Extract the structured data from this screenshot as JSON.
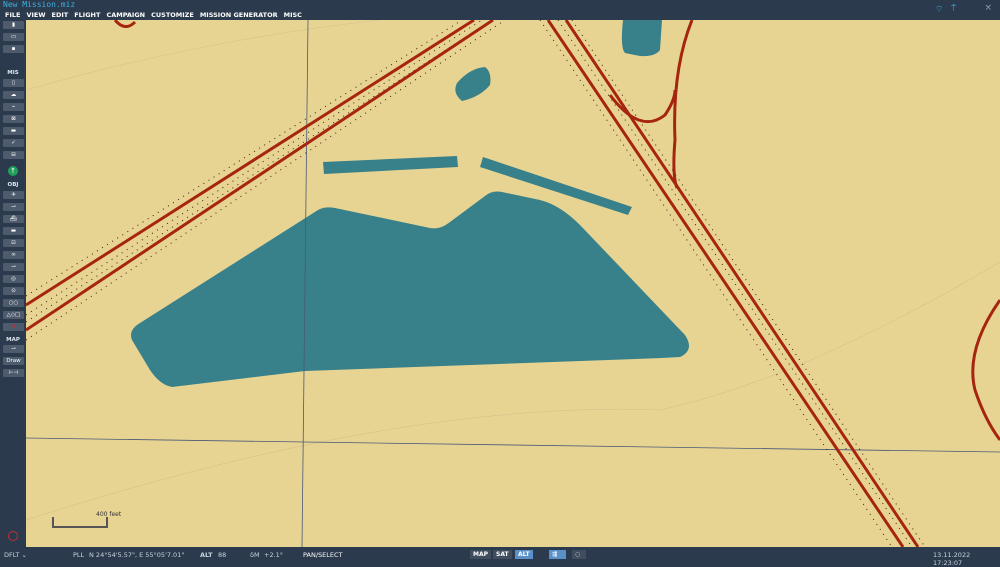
{
  "window": {
    "title": "New Mission.miz",
    "close": "×"
  },
  "menu": [
    "FILE",
    "VIEW",
    "EDIT",
    "FLIGHT",
    "CAMPAIGN",
    "CUSTOMIZE",
    "MISSION GENERATOR",
    "MISC"
  ],
  "sidebar": {
    "file_buttons": [
      "new-file",
      "open-file",
      "save-file"
    ],
    "mis_label": "MIS",
    "mis_buttons": [
      "briefing",
      "weather",
      "triggers",
      "goals",
      "failures",
      "check",
      "resources"
    ],
    "obj_label": "OBJ",
    "obj_buttons": [
      "airplane",
      "helicopter",
      "ship",
      "ground-vehicle",
      "static",
      "templates",
      "initial-point",
      "zone",
      "nav-target",
      "tacan",
      "shapes",
      "delete"
    ],
    "map_label": "MAP",
    "map_buttons": [
      "key",
      "Draw",
      "ruler"
    ]
  },
  "map": {
    "scale_label": "400 feet"
  },
  "status": {
    "profile": "DFLT ⌄",
    "coord_label": "PLL",
    "coords": "N 24°54'5.57\", E 55°05'7.01\"",
    "alt_label": "ALT",
    "alt": "88",
    "mag_label": "δM",
    "mag": "+2.1°",
    "mode": "PAN/SELECT",
    "map_modes": [
      "MAP",
      "SAT",
      "ALT"
    ],
    "active_mode": "ALT",
    "datetime": "13.11.2022 17:23:07"
  },
  "colors": {
    "land": "#e8d492",
    "water": "#38818a",
    "road": "#a6250f",
    "chrome": "#2b3a4c",
    "accent": "#3ab0e0"
  }
}
